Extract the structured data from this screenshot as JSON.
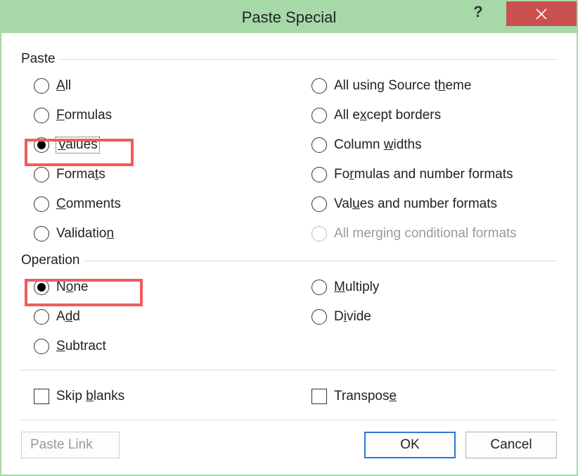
{
  "titlebar": {
    "title": "Paste Special",
    "help": "?",
    "close_icon": "close-icon"
  },
  "groups": {
    "paste": "Paste",
    "operation": "Operation"
  },
  "paste_left": [
    {
      "key": "all",
      "prefix": "",
      "accel": "A",
      "suffix": "ll",
      "checked": false,
      "name": "radio-all"
    },
    {
      "key": "formulas",
      "prefix": "",
      "accel": "F",
      "suffix": "ormulas",
      "checked": false,
      "name": "radio-formulas"
    },
    {
      "key": "values",
      "prefix": "",
      "accel": "V",
      "suffix": "alues",
      "checked": true,
      "name": "radio-values",
      "focus": true
    },
    {
      "key": "formats",
      "prefix": "Forma",
      "accel": "t",
      "suffix": "s",
      "checked": false,
      "name": "radio-formats"
    },
    {
      "key": "comments",
      "prefix": "",
      "accel": "C",
      "suffix": "omments",
      "checked": false,
      "name": "radio-comments"
    },
    {
      "key": "validation",
      "prefix": "Validatio",
      "accel": "n",
      "suffix": "",
      "checked": false,
      "name": "radio-validation"
    }
  ],
  "paste_right": [
    {
      "key": "all_src_theme",
      "prefix": "All using Source t",
      "accel": "h",
      "suffix": "eme",
      "checked": false,
      "name": "radio-all-source-theme"
    },
    {
      "key": "all_except_b",
      "prefix": "All e",
      "accel": "x",
      "suffix": "cept borders",
      "checked": false,
      "name": "radio-all-except-borders"
    },
    {
      "key": "col_widths",
      "prefix": "Column ",
      "accel": "w",
      "suffix": "idths",
      "checked": false,
      "name": "radio-column-widths"
    },
    {
      "key": "fml_num_fmt",
      "prefix": "Fo",
      "accel": "r",
      "suffix": "mulas and number formats",
      "checked": false,
      "name": "radio-formulas-number-formats"
    },
    {
      "key": "val_num_fmt",
      "prefix": "Val",
      "accel": "u",
      "suffix": "es and number formats",
      "checked": false,
      "name": "radio-values-number-formats"
    },
    {
      "key": "all_merge_cf",
      "prefix": "All mer",
      "accel": "g",
      "suffix": "ing conditional formats",
      "checked": false,
      "name": "radio-all-merging-conditional-formats",
      "disabled": true
    }
  ],
  "op_left": [
    {
      "key": "none",
      "prefix": "N",
      "accel": "o",
      "suffix": "ne",
      "checked": true,
      "name": "radio-none"
    },
    {
      "key": "add",
      "prefix": "A",
      "accel": "d",
      "suffix": "d",
      "checked": false,
      "name": "radio-add"
    },
    {
      "key": "subtract",
      "prefix": "",
      "accel": "S",
      "suffix": "ubtract",
      "checked": false,
      "name": "radio-subtract"
    }
  ],
  "op_right": [
    {
      "key": "multiply",
      "prefix": "",
      "accel": "M",
      "suffix": "ultiply",
      "checked": false,
      "name": "radio-multiply"
    },
    {
      "key": "divide",
      "prefix": "D",
      "accel": "i",
      "suffix": "vide",
      "checked": false,
      "name": "radio-divide"
    }
  ],
  "checks": {
    "skip_blanks": {
      "prefix": "Skip ",
      "accel": "b",
      "suffix": "lanks",
      "checked": false,
      "name": "checkbox-skip-blanks"
    },
    "transpose": {
      "prefix": "Transpos",
      "accel": "e",
      "suffix": "",
      "checked": false,
      "name": "checkbox-transpose"
    }
  },
  "buttons": {
    "paste_link": "Paste Link",
    "ok": "OK",
    "cancel": "Cancel"
  }
}
